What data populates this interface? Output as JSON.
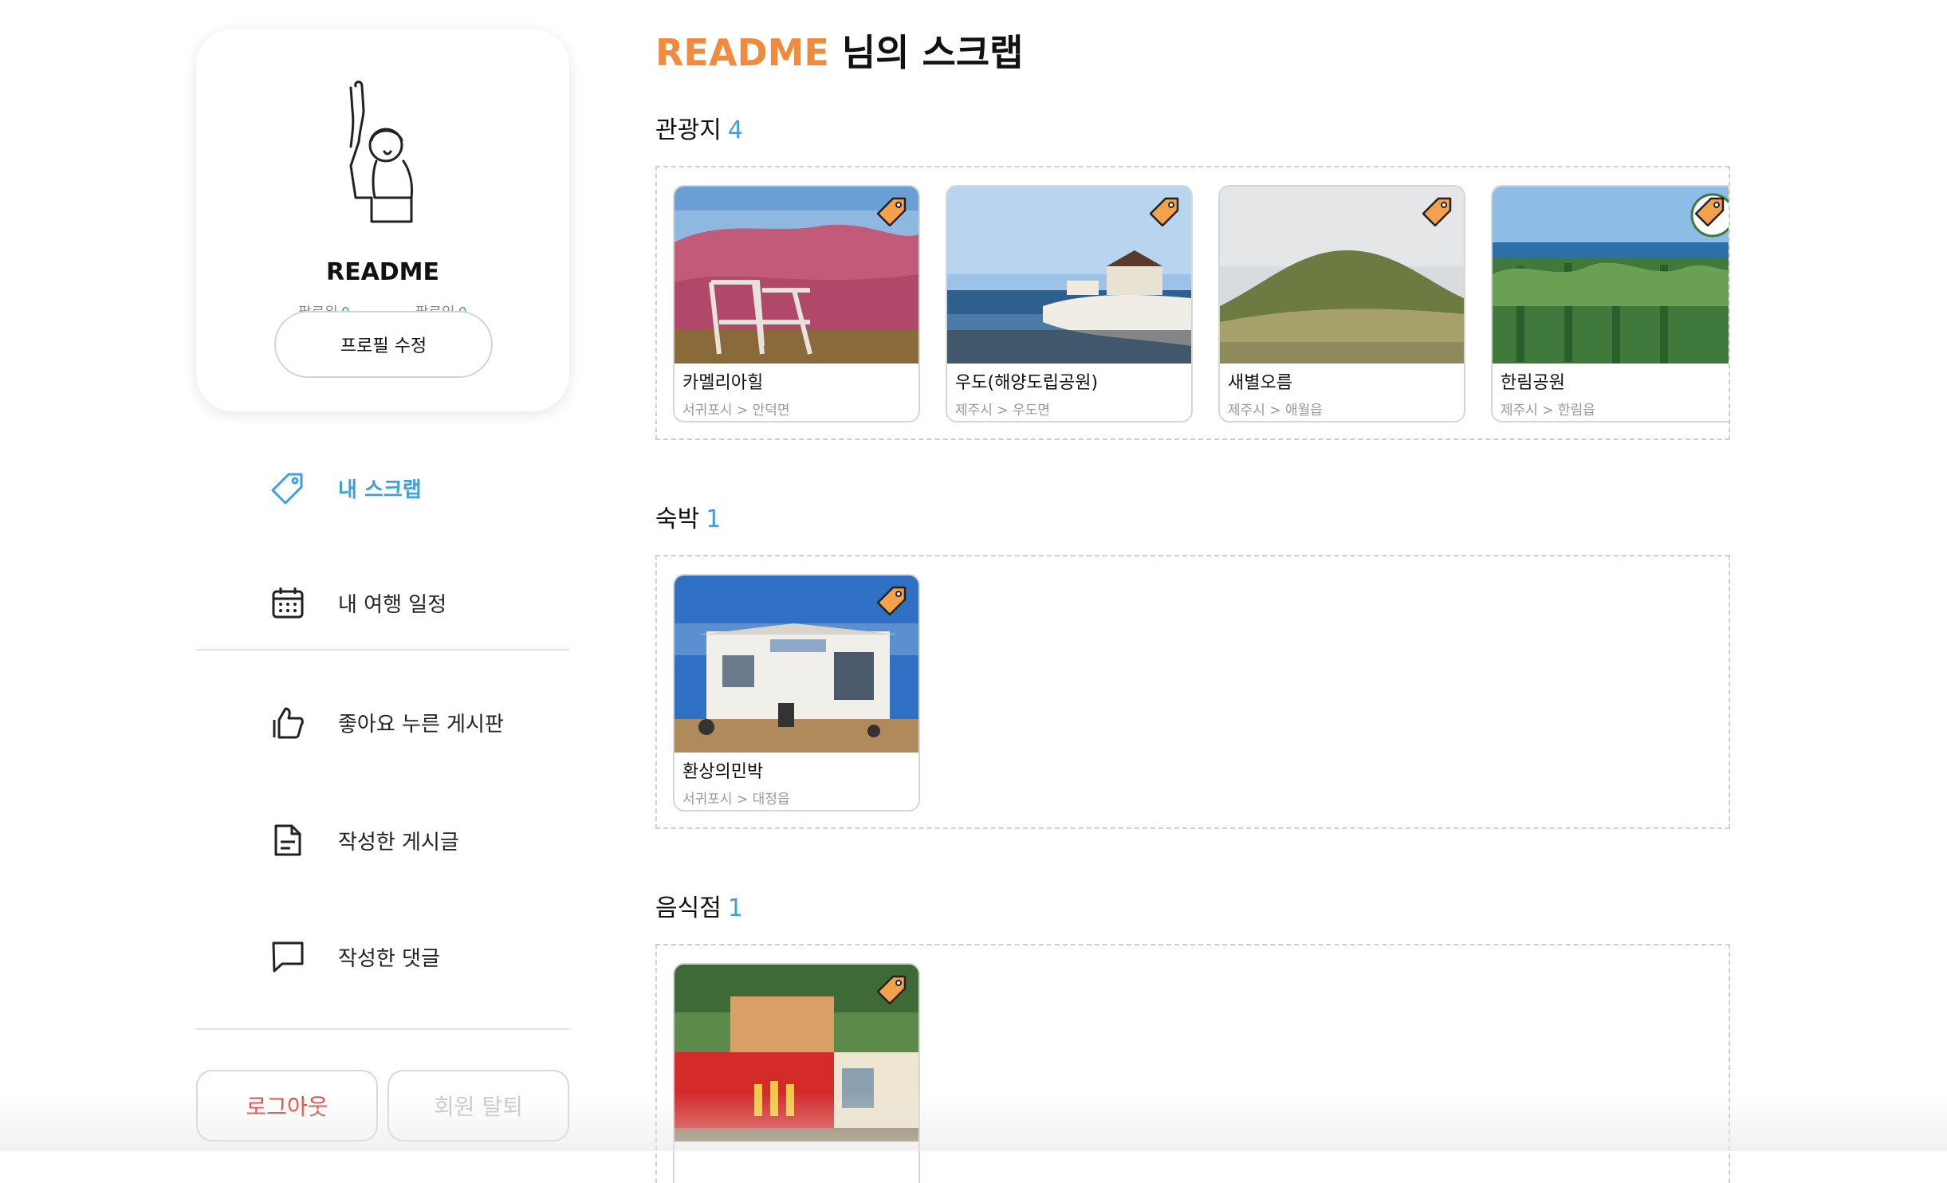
{
  "profile": {
    "name": "README",
    "follower_label": "팔로워",
    "follower_count": "0",
    "following_label": "팔로잉",
    "following_count": "0",
    "edit_button": "프로필 수정"
  },
  "menu": [
    {
      "label": "내 스크랩",
      "icon": "tag-icon",
      "active": true
    },
    {
      "label": "내 여행 일정",
      "icon": "calendar-icon",
      "active": false
    },
    {
      "label": "좋아요 누른 게시판",
      "icon": "thumbs-up-icon",
      "active": false
    },
    {
      "label": "작성한 게시글",
      "icon": "document-icon",
      "active": false
    },
    {
      "label": "작성한 댓글",
      "icon": "comment-icon",
      "active": false
    }
  ],
  "account": {
    "logout": "로그아웃",
    "withdraw": "회원 탈퇴"
  },
  "page": {
    "username": "README",
    "title_suffix": " 님의 스크랩"
  },
  "sections": [
    {
      "title": "관광지",
      "count": "4",
      "items": [
        {
          "name": "카멜리아힐",
          "address": "서귀포시 > 안덕면"
        },
        {
          "name": "우도(해양도립공원)",
          "address": "제주시 > 우도면"
        },
        {
          "name": "새별오름",
          "address": "제주시 > 애월읍"
        },
        {
          "name": "한림공원",
          "address": "제주시 > 한림읍"
        }
      ]
    },
    {
      "title": "숙박",
      "count": "1",
      "items": [
        {
          "name": "환상의민박",
          "address": "서귀포시 > 대정읍"
        }
      ]
    },
    {
      "title": "음식점",
      "count": "1",
      "items": [
        {
          "name": "",
          "address": ""
        }
      ]
    }
  ],
  "colors": {
    "accent_orange": "#f08a3c",
    "accent_blue": "#3fa0de",
    "danger_red": "#e0443c"
  }
}
